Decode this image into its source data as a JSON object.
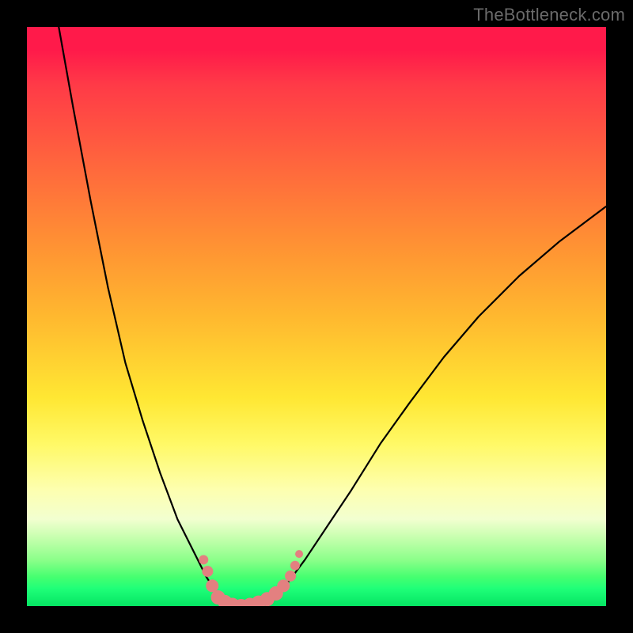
{
  "watermark": "TheBottleneck.com",
  "frame": {
    "outer_bg": "#000000",
    "border_px": 34,
    "plot_size": 732
  },
  "gradient_stops": [
    {
      "pos": 0.0,
      "color": "#ff1a4a"
    },
    {
      "pos": 0.04,
      "color": "#ff1a4a"
    },
    {
      "pos": 0.1,
      "color": "#ff3a47"
    },
    {
      "pos": 0.25,
      "color": "#ff6a3c"
    },
    {
      "pos": 0.38,
      "color": "#ff9333"
    },
    {
      "pos": 0.5,
      "color": "#ffb82f"
    },
    {
      "pos": 0.64,
      "color": "#ffe733"
    },
    {
      "pos": 0.72,
      "color": "#fff966"
    },
    {
      "pos": 0.8,
      "color": "#fdffb0"
    },
    {
      "pos": 0.85,
      "color": "#f2ffd0"
    },
    {
      "pos": 0.88,
      "color": "#c9ffb0"
    },
    {
      "pos": 0.92,
      "color": "#8cff8a"
    },
    {
      "pos": 0.95,
      "color": "#45ff70"
    },
    {
      "pos": 0.97,
      "color": "#1fff78"
    },
    {
      "pos": 1.0,
      "color": "#05e463"
    }
  ],
  "chart_data": {
    "type": "line",
    "title": "",
    "xlabel": "",
    "ylabel": "",
    "xlim": [
      0,
      100
    ],
    "ylim": [
      0,
      100
    ],
    "note": "y=100 at bottom (green), y=0 at top (red). V-shaped bottleneck curve with minimum near x≈37.",
    "series": [
      {
        "name": "bottleneck-curve",
        "points": [
          {
            "x": 5.5,
            "y": 0
          },
          {
            "x": 8,
            "y": 14
          },
          {
            "x": 11,
            "y": 30
          },
          {
            "x": 14,
            "y": 45
          },
          {
            "x": 17,
            "y": 58
          },
          {
            "x": 20,
            "y": 68
          },
          {
            "x": 23,
            "y": 77
          },
          {
            "x": 26,
            "y": 85
          },
          {
            "x": 29,
            "y": 91
          },
          {
            "x": 31,
            "y": 95
          },
          {
            "x": 33,
            "y": 98
          },
          {
            "x": 35,
            "y": 99.5
          },
          {
            "x": 37,
            "y": 100
          },
          {
            "x": 40,
            "y": 99.5
          },
          {
            "x": 42,
            "y": 98.5
          },
          {
            "x": 45,
            "y": 96
          },
          {
            "x": 48,
            "y": 92
          },
          {
            "x": 52,
            "y": 86
          },
          {
            "x": 56,
            "y": 80
          },
          {
            "x": 61,
            "y": 72
          },
          {
            "x": 66,
            "y": 65
          },
          {
            "x": 72,
            "y": 57
          },
          {
            "x": 78,
            "y": 50
          },
          {
            "x": 85,
            "y": 43
          },
          {
            "x": 92,
            "y": 37
          },
          {
            "x": 100,
            "y": 31
          }
        ]
      }
    ],
    "markers": {
      "color": "#e38080",
      "radius_large": 9,
      "radius_small": 6,
      "points": [
        {
          "x": 30.5,
          "y": 92,
          "r": 6
        },
        {
          "x": 31.2,
          "y": 94,
          "r": 7
        },
        {
          "x": 32.0,
          "y": 96.5,
          "r": 8
        },
        {
          "x": 33.0,
          "y": 98.5,
          "r": 9
        },
        {
          "x": 34.2,
          "y": 99.3,
          "r": 9
        },
        {
          "x": 35.5,
          "y": 99.8,
          "r": 9
        },
        {
          "x": 37.0,
          "y": 100,
          "r": 9
        },
        {
          "x": 38.5,
          "y": 99.8,
          "r": 9
        },
        {
          "x": 40.0,
          "y": 99.4,
          "r": 9
        },
        {
          "x": 41.5,
          "y": 98.8,
          "r": 9
        },
        {
          "x": 43.0,
          "y": 97.8,
          "r": 9
        },
        {
          "x": 44.3,
          "y": 96.5,
          "r": 8
        },
        {
          "x": 45.5,
          "y": 94.8,
          "r": 7
        },
        {
          "x": 46.3,
          "y": 93.0,
          "r": 6
        },
        {
          "x": 47.0,
          "y": 91.0,
          "r": 5
        }
      ]
    }
  }
}
